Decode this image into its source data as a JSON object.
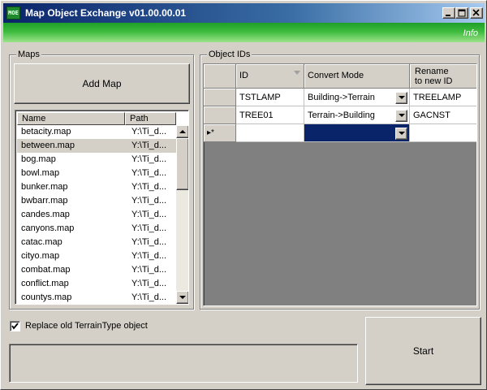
{
  "window": {
    "title": "Map Object Exchange v01.00.00.01",
    "icon_text": "MOE",
    "icon": "app-moe-icon",
    "controls": [
      "minimize-icon",
      "maximize-icon",
      "close-icon"
    ]
  },
  "infobar": {
    "info_label": "Info"
  },
  "maps": {
    "group_label": "Maps",
    "add_button": "Add Map",
    "columns": {
      "name": "Name",
      "path": "Path"
    },
    "rows": [
      {
        "name": "betacity.map",
        "path": "Y:\\Ti_d..."
      },
      {
        "name": "between.map",
        "path": "Y:\\Ti_d..."
      },
      {
        "name": "bog.map",
        "path": "Y:\\Ti_d..."
      },
      {
        "name": "bowl.map",
        "path": "Y:\\Ti_d..."
      },
      {
        "name": "bunker.map",
        "path": "Y:\\Ti_d..."
      },
      {
        "name": "bwbarr.map",
        "path": "Y:\\Ti_d..."
      },
      {
        "name": "candes.map",
        "path": "Y:\\Ti_d..."
      },
      {
        "name": "canyons.map",
        "path": "Y:\\Ti_d..."
      },
      {
        "name": "catac.map",
        "path": "Y:\\Ti_d..."
      },
      {
        "name": "cityo.map",
        "path": "Y:\\Ti_d..."
      },
      {
        "name": "combat.map",
        "path": "Y:\\Ti_d..."
      },
      {
        "name": "conflict.map",
        "path": "Y:\\Ti_d..."
      },
      {
        "name": "countys.map",
        "path": "Y:\\Ti_d..."
      }
    ],
    "selected_row": "between.map"
  },
  "object_ids": {
    "group_label": "Object IDs",
    "columns": {
      "id": "ID",
      "mode": "Convert Mode",
      "rename_line1": "Rename",
      "rename_line2": "to new ID"
    },
    "rows": [
      {
        "id": "TSTLAMP",
        "mode": "Building->Terrain",
        "rename": "TREELAMP"
      },
      {
        "id": "TREE01",
        "mode": "Terrain->Building",
        "rename": "GACNST"
      }
    ],
    "new_row_marker": "▸*",
    "colors": {
      "selected_cell": "#0a246a",
      "grid_background": "#808080"
    }
  },
  "options": {
    "replace_label": "Replace old TerrainType object",
    "replace_checked": true
  },
  "actions": {
    "start_label": "Start"
  },
  "status": {
    "text": ""
  },
  "theme": {
    "title_gradient_start": "#0a246a",
    "info_bar_green": "#1f9f2a",
    "face": "#d4d0c8"
  }
}
